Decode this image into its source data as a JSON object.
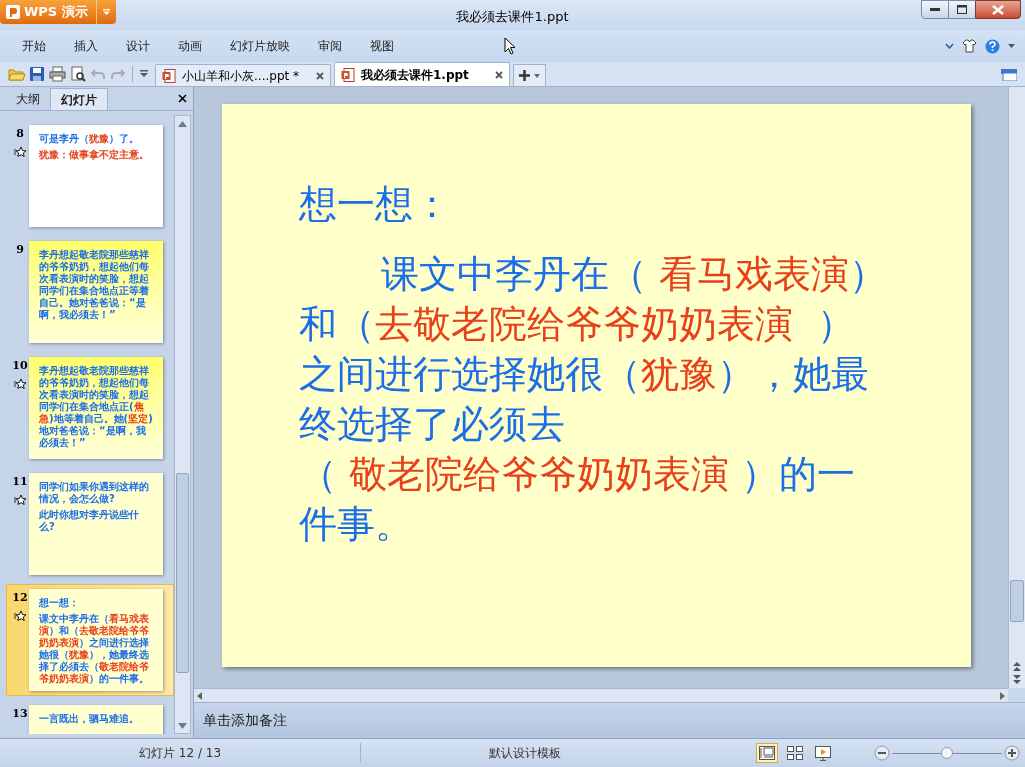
{
  "app_button": {
    "label": "WPS 演示"
  },
  "window": {
    "title": "我必须去课件1.ppt"
  },
  "menu": [
    {
      "label": "开始"
    },
    {
      "label": "插入"
    },
    {
      "label": "设计"
    },
    {
      "label": "动画"
    },
    {
      "label": "幻灯片放映"
    },
    {
      "label": "审阅"
    },
    {
      "label": "视图"
    }
  ],
  "doc_tabs": [
    {
      "label": "小山羊和小灰....ppt *",
      "selected": false
    },
    {
      "label": "我必须去课件1.ppt",
      "selected": true
    }
  ],
  "side_tabs": [
    {
      "label": "大纲",
      "selected": false
    },
    {
      "label": "幻灯片",
      "selected": true
    }
  ],
  "slides": [
    {
      "number": "8",
      "animated": true,
      "selected": false,
      "kind": "white",
      "paragraphs": [
        [
          {
            "text": "可是李丹（",
            "kind": "normal"
          },
          {
            "text": "犹豫",
            "kind": "answer"
          },
          {
            "text": "）了。",
            "kind": "normal"
          }
        ],
        [
          {
            "text": "犹豫：做事拿不定主意。",
            "kind": "answer"
          }
        ]
      ]
    },
    {
      "number": "9",
      "animated": false,
      "selected": false,
      "kind": "yellow",
      "paragraphs": [
        [
          {
            "text": "李丹想起敬老院那些慈祥的爷爷奶奶，想起他们每次看表演时的笑脸，想起同学们在集合地点正等着自己。她对爸爸说：“是啊，我必须去！”",
            "kind": "normal"
          }
        ]
      ]
    },
    {
      "number": "10",
      "animated": true,
      "selected": false,
      "kind": "yellow",
      "paragraphs": [
        [
          {
            "text": "李丹想起敬老院那些慈祥的爷爷奶奶，想起他们每次看表演时的笑脸，想起同学们在集合地点正(",
            "kind": "normal"
          },
          {
            "text": "焦急",
            "kind": "answer"
          },
          {
            "text": ")地等着自己。她(",
            "kind": "normal"
          },
          {
            "text": "坚定",
            "kind": "answer"
          },
          {
            "text": ")地对爸爸说：“是啊，我必须去！”",
            "kind": "normal"
          }
        ]
      ]
    },
    {
      "number": "11",
      "animated": true,
      "selected": false,
      "kind": "pale",
      "paragraphs": [
        [
          {
            "text": "同学们如果你遇到这样的情况，会怎么做?",
            "kind": "normal"
          }
        ],
        [
          {
            "text": "此时你想对李丹说些什么?",
            "kind": "normal"
          }
        ]
      ]
    },
    {
      "number": "12",
      "animated": true,
      "selected": true,
      "kind": "pale",
      "paragraphs": [
        [
          {
            "text": "想一想：",
            "kind": "normal"
          }
        ],
        [
          {
            "text": "课文中李丹在（",
            "kind": "normal"
          },
          {
            "text": "看马戏表演",
            "kind": "answer"
          },
          {
            "text": "）和（",
            "kind": "normal"
          },
          {
            "text": "去敬老院给爷爷奶奶表演",
            "kind": "answer"
          },
          {
            "text": "）之间进行选择她很（",
            "kind": "normal"
          },
          {
            "text": "犹豫",
            "kind": "answer"
          },
          {
            "text": "），她最终选择了必须去（",
            "kind": "normal"
          },
          {
            "text": "敬老院给爷爷奶奶表演",
            "kind": "answer"
          },
          {
            "text": "）的一件事。",
            "kind": "normal"
          }
        ]
      ]
    },
    {
      "number": "13",
      "animated": false,
      "selected": false,
      "kind": "pale",
      "paragraphs": [
        [
          {
            "text": "一言既出，驷马难追。",
            "kind": "normal"
          }
        ]
      ]
    }
  ],
  "main_slide": {
    "lines": [
      [
        {
          "text": "想一想：",
          "kind": "normal"
        }
      ],
      [
        {
          "text": "课文中李丹在（ ",
          "kind": "normal"
        },
        {
          "text": "看马戏表演",
          "kind": "answer"
        },
        {
          "text": "）",
          "kind": "normal"
        }
      ],
      [
        {
          "text": "和（",
          "kind": "normal"
        },
        {
          "text": "去敬老院给爷爷奶奶表演  ",
          "kind": "answer"
        },
        {
          "text": "）",
          "kind": "normal"
        }
      ],
      [
        {
          "text": "之间进行选择她很（",
          "kind": "normal"
        },
        {
          "text": "犹豫",
          "kind": "answer"
        },
        {
          "text": "），她最",
          "kind": "normal"
        }
      ],
      [
        {
          "text": "终选择了必须去",
          "kind": "normal"
        }
      ],
      [
        {
          "text": "（ ",
          "kind": "normal"
        },
        {
          "text": "敬老院给爷爷奶奶表演",
          "kind": "answer"
        },
        {
          "text": " ）的一",
          "kind": "normal"
        }
      ],
      [
        {
          "text": "件事。",
          "kind": "normal"
        }
      ]
    ]
  },
  "notes": {
    "placeholder": "单击添加备注"
  },
  "status_bar": {
    "slide_counter": "幻灯片 12 / 13",
    "template": "默认设计模板"
  },
  "view_buttons": [
    {
      "kind": "normal",
      "selected": true
    },
    {
      "kind": "sorter",
      "selected": false
    },
    {
      "kind": "show",
      "selected": false
    }
  ],
  "zoom": {
    "level": 0.5
  }
}
